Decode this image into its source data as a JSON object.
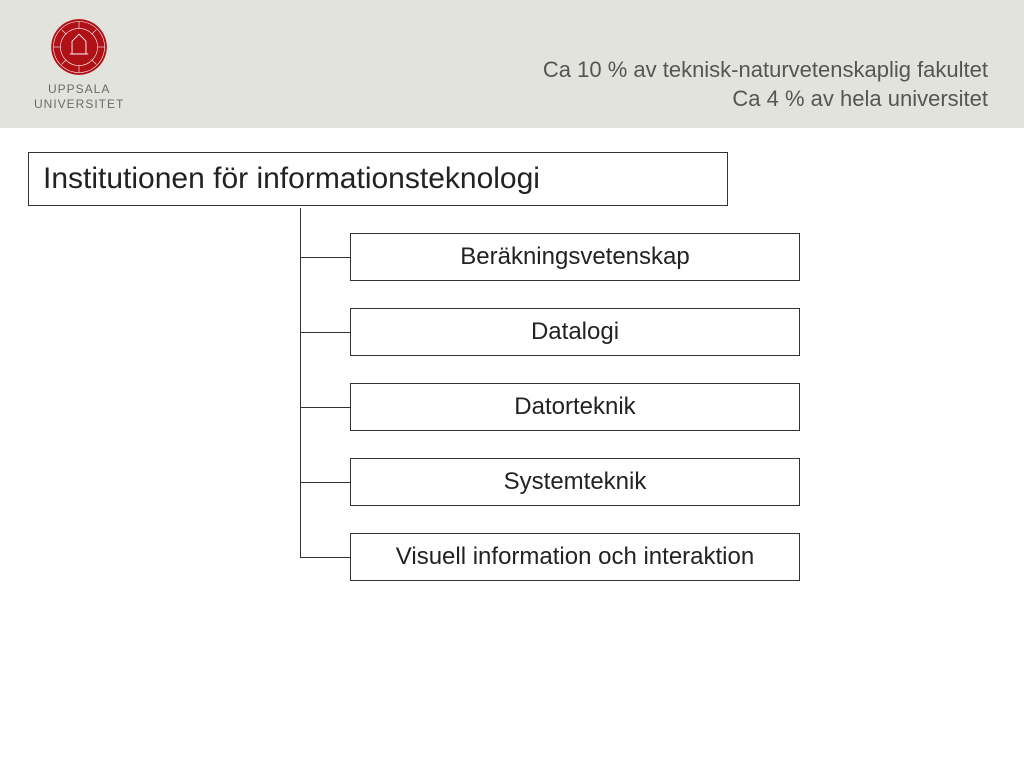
{
  "header": {
    "org_line1": "UPPSALA",
    "org_line2": "UNIVERSITET",
    "fact_line1": "Ca 10 % av teknisk-naturvetenskaplig fakultet",
    "fact_line2": "Ca 4 % av hela universitet"
  },
  "diagram": {
    "root": "Institutionen för informationsteknologi",
    "children": [
      "Beräkningsvetenskap",
      "Datalogi",
      "Datorteknik",
      "Systemteknik",
      "Visuell information och interaktion"
    ]
  },
  "colors": {
    "seal": "#b01116",
    "header_bg": "#e3e3dd",
    "box_border": "#333333"
  }
}
